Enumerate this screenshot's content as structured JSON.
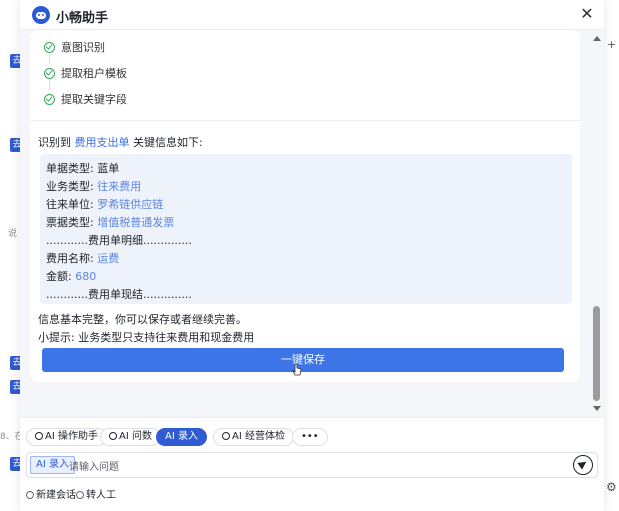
{
  "window": {
    "title": "小畅助手",
    "close_icon": "close-icon"
  },
  "steps": [
    {
      "label": "意图识别",
      "status": "done"
    },
    {
      "label": "提取租户模板",
      "status": "done"
    },
    {
      "label": "提取关键字段",
      "status": "done"
    }
  ],
  "result": {
    "intro_prefix": "识别到",
    "intro_link": "费用支出单",
    "intro_suffix": "关键信息如下:",
    "fields": [
      {
        "label": "单据类型: ",
        "value": "",
        "plain": "蓝单"
      },
      {
        "label": "业务类型: ",
        "value": "往来费用",
        "plain": ""
      },
      {
        "label": "往来单位: ",
        "value": "罗希链供应链",
        "plain": ""
      },
      {
        "label": "票据类型: ",
        "value": "增值税普通发票",
        "plain": ""
      },
      {
        "label": "",
        "value": "",
        "plain": "............费用单明细.............."
      },
      {
        "label": "费用名称: ",
        "value": "运费",
        "plain": ""
      },
      {
        "label": "金额: ",
        "value": "680",
        "plain": ""
      },
      {
        "label": "",
        "value": "",
        "plain": "............费用单现结.............."
      }
    ],
    "complete_note": "信息基本完整，你可以保存或者继续完善。",
    "tip": "小提示:  业务类型只支持往来费用和现金费用",
    "save_button": "一键保存"
  },
  "feedback": {
    "like_icon": "thumbs-up-icon",
    "dislike_icon": "thumbs-down-icon"
  },
  "toolbar": {
    "chips": [
      {
        "label": "AI 操作助手",
        "active": false
      },
      {
        "label": "AI 问数",
        "active": false
      },
      {
        "label": "AI 录入",
        "active": true
      },
      {
        "label": "AI 经营体检",
        "active": false
      },
      {
        "label": "•••",
        "active": false
      }
    ]
  },
  "input": {
    "mode_tag": "AI 录入",
    "placeholder": "请输入问题"
  },
  "footer": {
    "new_chat": "新建会话",
    "transfer_human": "转人工"
  },
  "background": {
    "chip_text": "去",
    "side_text_1": "说",
    "side_text_2": "8、在"
  },
  "colors": {
    "accent": "#2f5bd3",
    "button": "#3d74e8",
    "success": "#2eaa5a",
    "link": "#5b86e5"
  }
}
